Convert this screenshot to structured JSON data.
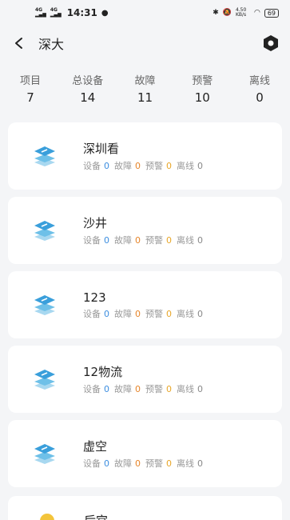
{
  "status_bar": {
    "network_1": "4G",
    "network_2": "4G",
    "time": "14:31",
    "speed": "4.50 KB/s",
    "battery": "69"
  },
  "header": {
    "title": "深大"
  },
  "stats": [
    {
      "label": "项目",
      "value": "7"
    },
    {
      "label": "总设备",
      "value": "14"
    },
    {
      "label": "故障",
      "value": "11"
    },
    {
      "label": "预警",
      "value": "10"
    },
    {
      "label": "离线",
      "value": "0"
    }
  ],
  "stat_labels": {
    "devices": "设备",
    "faults": "故障",
    "warnings": "预警",
    "offline": "离线"
  },
  "projects": [
    {
      "name": "深圳看",
      "devices": "0",
      "faults": "0",
      "warnings": "0",
      "offline": "0"
    },
    {
      "name": "沙井",
      "devices": "0",
      "faults": "0",
      "warnings": "0",
      "offline": "0"
    },
    {
      "name": "123",
      "devices": "0",
      "faults": "0",
      "warnings": "0",
      "offline": "0"
    },
    {
      "name": "12物流",
      "devices": "0",
      "faults": "0",
      "warnings": "0",
      "offline": "0"
    },
    {
      "name": "虚空",
      "devices": "0",
      "faults": "0",
      "warnings": "0",
      "offline": "0"
    }
  ],
  "partial_project": {
    "name": "后宫"
  },
  "colors": {
    "devices": "#3d8ee0",
    "faults": "#e6862c",
    "warnings": "#e8a72a",
    "offline": "#888888",
    "background": "#f4f5f7"
  },
  "icons": {
    "back": "chevron-left-icon",
    "settings": "hexagon-gear-icon",
    "project": "stacked-layers-icon"
  }
}
